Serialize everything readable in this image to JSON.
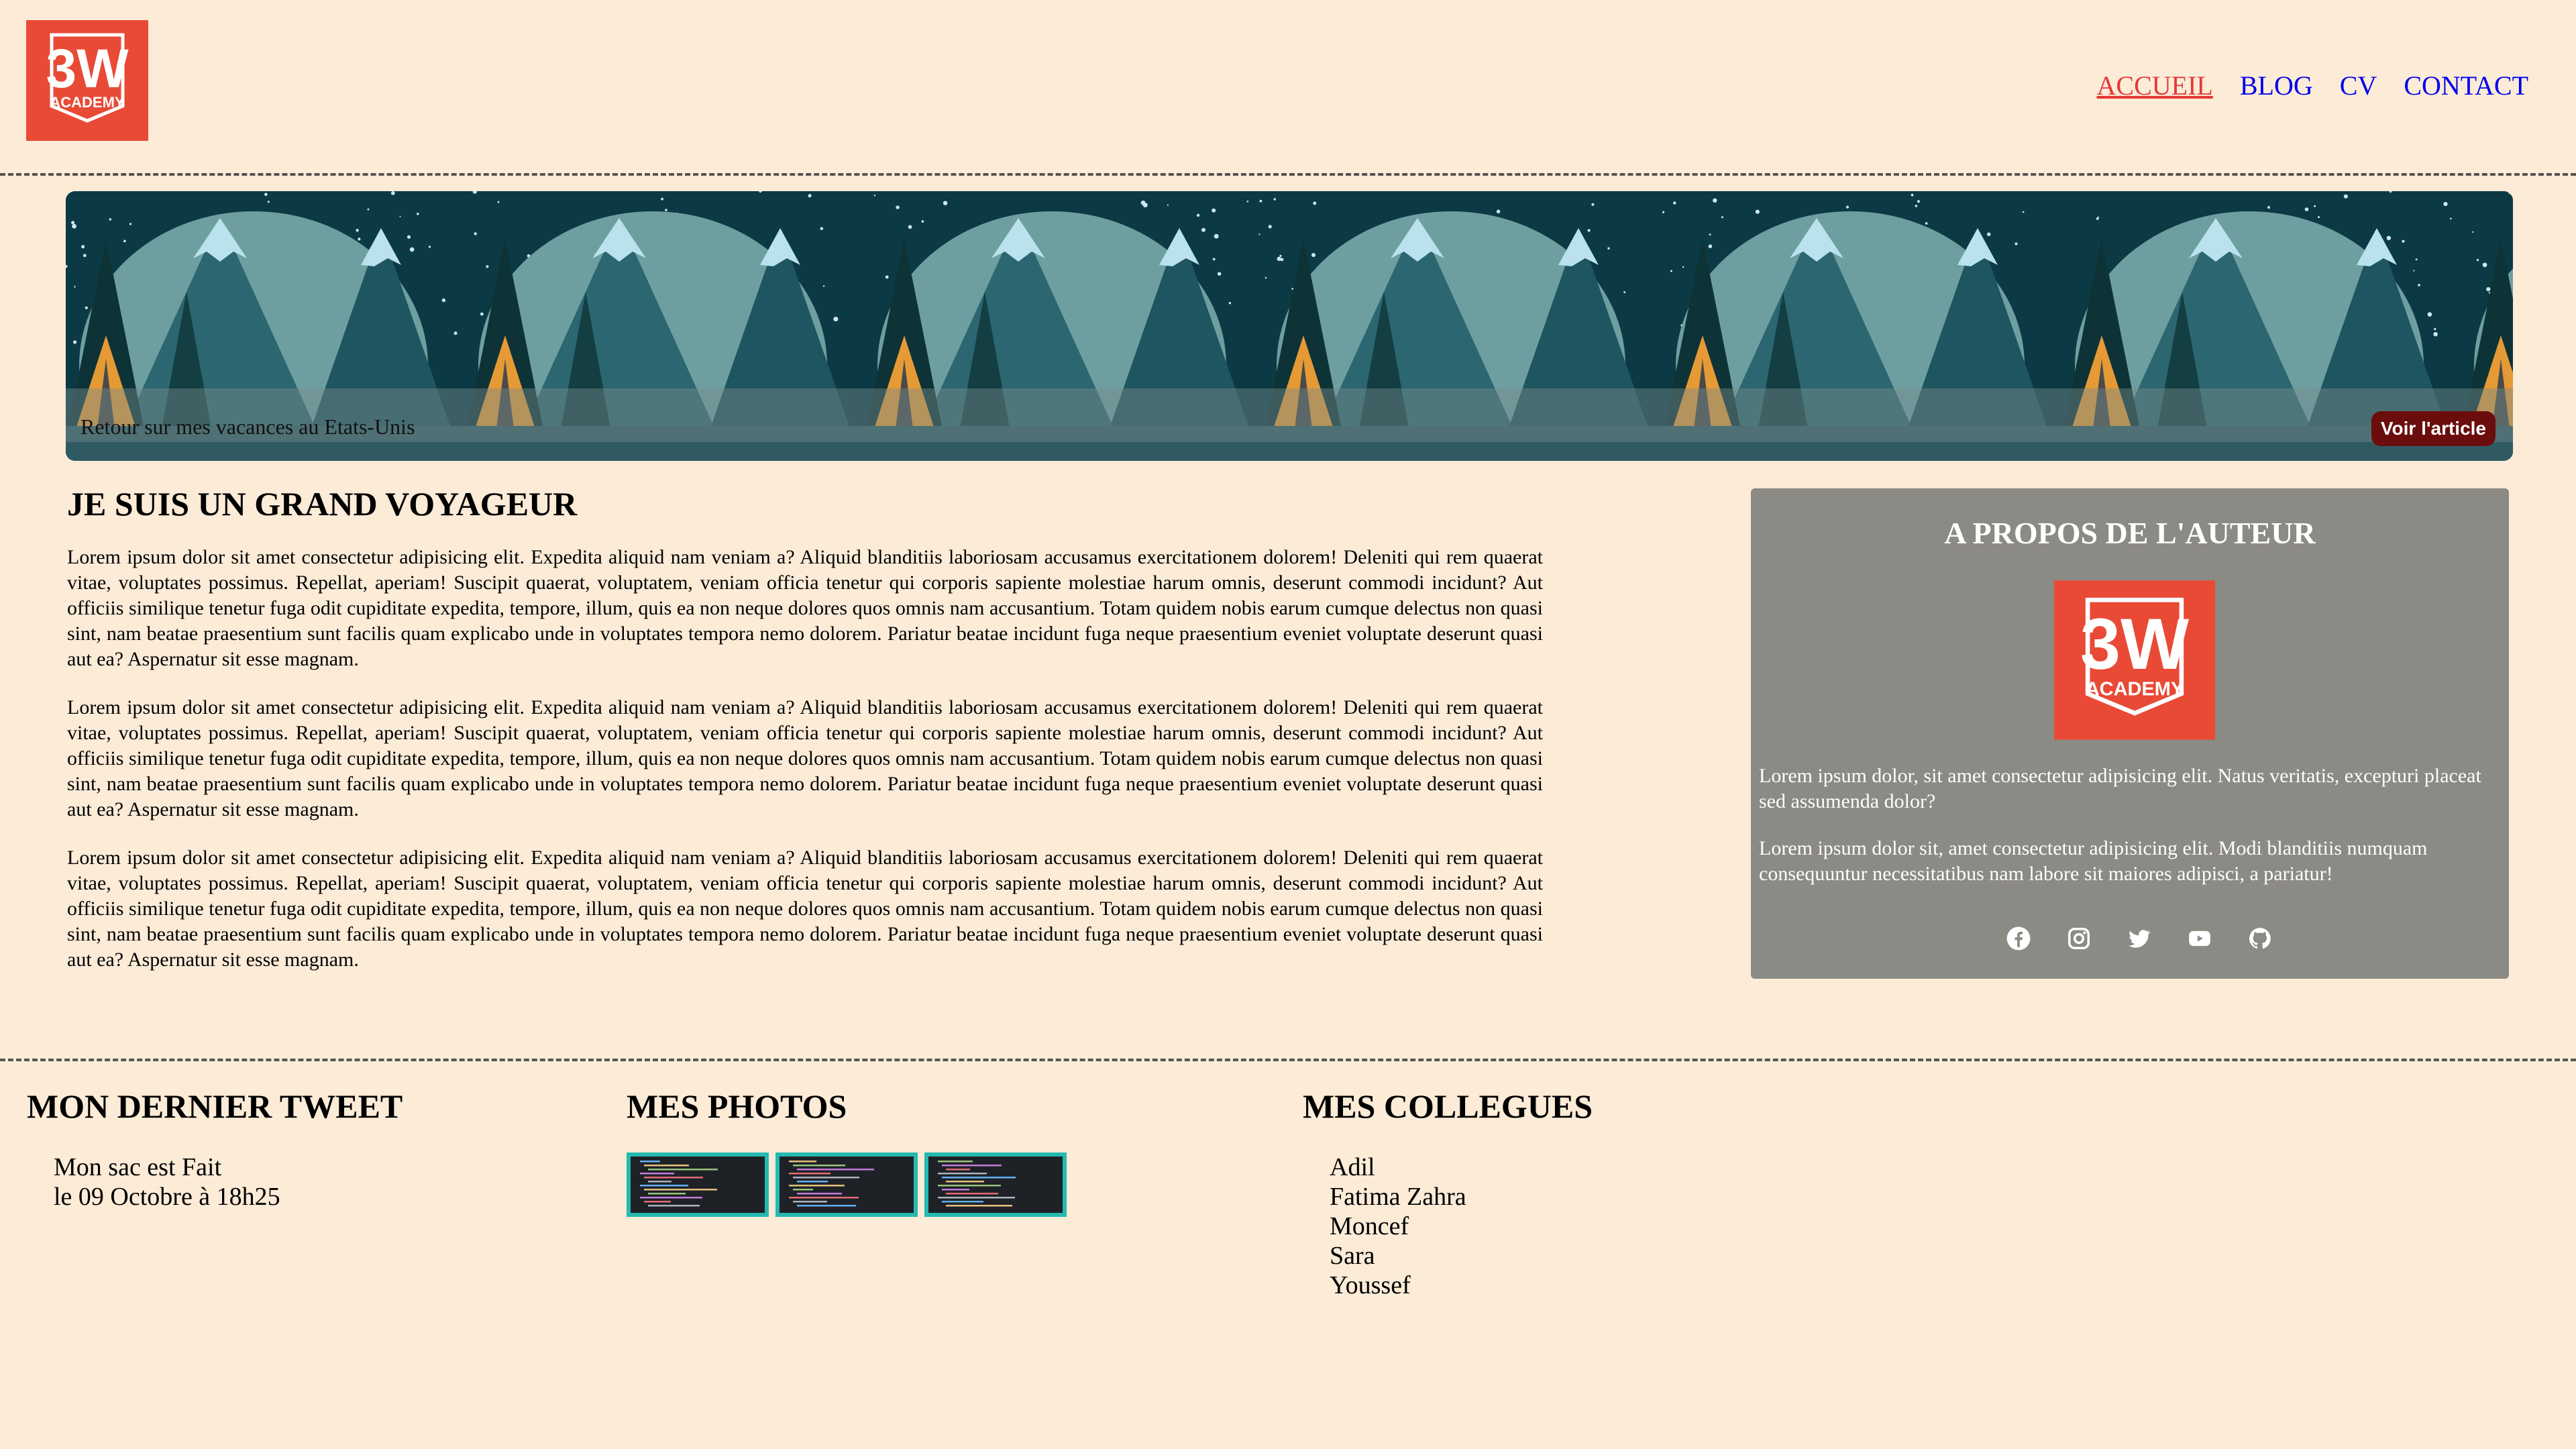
{
  "header": {
    "logo_text_top": "3W",
    "logo_text_bottom": "ACADEMY",
    "nav": [
      {
        "label": "ACCUEIL",
        "active": true
      },
      {
        "label": "BLOG",
        "active": false
      },
      {
        "label": "CV",
        "active": false
      },
      {
        "label": "CONTACT",
        "active": false
      }
    ]
  },
  "banner": {
    "caption": "Retour sur mes vacances au Etats-Unis",
    "button_label": "Voir l'article"
  },
  "article": {
    "title": "JE SUIS UN GRAND VOYAGEUR",
    "paragraphs": [
      "Lorem ipsum dolor sit amet consectetur adipisicing elit. Expedita aliquid nam veniam a? Aliquid blanditiis laboriosam accusamus exercitationem dolorem! Deleniti qui rem quaerat vitae, voluptates possimus. Repellat, aperiam! Suscipit quaerat, voluptatem, veniam officia tenetur qui corporis sapiente molestiae harum omnis, deserunt commodi incidunt? Aut officiis similique tenetur fuga odit cupiditate expedita, tempore, illum, quis ea non neque dolores quos omnis nam accusantium. Totam quidem nobis earum cumque delectus non quasi sint, nam beatae praesentium sunt facilis quam explicabo unde in voluptates tempora nemo dolorem. Pariatur beatae incidunt fuga neque praesentium eveniet voluptate deserunt quasi aut ea? Aspernatur sit esse magnam.",
      "Lorem ipsum dolor sit amet consectetur adipisicing elit. Expedita aliquid nam veniam a? Aliquid blanditiis laboriosam accusamus exercitationem dolorem! Deleniti qui rem quaerat vitae, voluptates possimus. Repellat, aperiam! Suscipit quaerat, voluptatem, veniam officia tenetur qui corporis sapiente molestiae harum omnis, deserunt commodi incidunt? Aut officiis similique tenetur fuga odit cupiditate expedita, tempore, illum, quis ea non neque dolores quos omnis nam accusantium. Totam quidem nobis earum cumque delectus non quasi sint, nam beatae praesentium sunt facilis quam explicabo unde in voluptates tempora nemo dolorem. Pariatur beatae incidunt fuga neque praesentium eveniet voluptate deserunt quasi aut ea? Aspernatur sit esse magnam.",
      "Lorem ipsum dolor sit amet consectetur adipisicing elit. Expedita aliquid nam veniam a? Aliquid blanditiis laboriosam accusamus exercitationem dolorem! Deleniti qui rem quaerat vitae, voluptates possimus. Repellat, aperiam! Suscipit quaerat, voluptatem, veniam officia tenetur qui corporis sapiente molestiae harum omnis, deserunt commodi incidunt? Aut officiis similique tenetur fuga odit cupiditate expedita, tempore, illum, quis ea non neque dolores quos omnis nam accusantium. Totam quidem nobis earum cumque delectus non quasi sint, nam beatae praesentium sunt facilis quam explicabo unde in voluptates tempora nemo dolorem. Pariatur beatae incidunt fuga neque praesentium eveniet voluptate deserunt quasi aut ea? Aspernatur sit esse magnam."
    ]
  },
  "aside": {
    "title": "A PROPOS DE L'AUTEUR",
    "paragraph1": "Lorem ipsum dolor, sit amet consectetur adipisicing elit. Natus veritatis, excepturi placeat sed assumenda dolor?",
    "paragraph2": "Lorem ipsum dolor sit, amet consectetur adipisicing elit. Modi blanditiis numquam consequuntur necessitatibus nam labore sit maiores adipisci, a pariatur!",
    "socials": [
      "facebook-icon",
      "instagram-icon",
      "twitter-icon",
      "youtube-icon",
      "github-icon"
    ]
  },
  "footer": {
    "tweet": {
      "title": "MON DERNIER TWEET",
      "text": "Mon sac est Fait",
      "date": "le 09 Octobre à 18h25"
    },
    "photos": {
      "title": "MES PHOTOS",
      "count": 3
    },
    "colleagues": {
      "title": "MES COLLEGUES",
      "names": [
        "Adil",
        "Fatima Zahra",
        "Moncef",
        "Sara",
        "Youssef"
      ]
    }
  },
  "colors": {
    "background": "#FBEBD7",
    "nav_active": "#E53935",
    "nav_link": "#0000EE",
    "logo_red": "#E84A36",
    "aside_bg": "#8C8A84",
    "button_bg": "#6B0D0D",
    "thumb_border": "#25B9B0"
  }
}
